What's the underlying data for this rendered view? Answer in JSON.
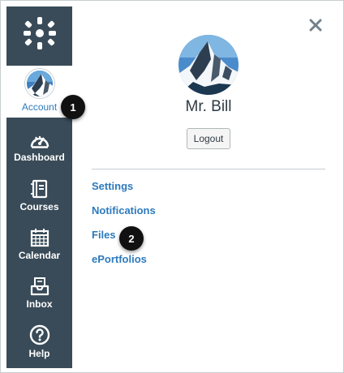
{
  "nav": {
    "logo_icon": "canvas-logo-icon",
    "account": {
      "label": "Account",
      "icon": "user-avatar"
    },
    "items": [
      {
        "label": "Dashboard",
        "icon": "dashboard-gauge-icon"
      },
      {
        "label": "Courses",
        "icon": "courses-book-icon"
      },
      {
        "label": "Calendar",
        "icon": "calendar-icon"
      },
      {
        "label": "Inbox",
        "icon": "inbox-tray-icon"
      },
      {
        "label": "Help",
        "icon": "help-question-icon"
      }
    ]
  },
  "tray": {
    "close_icon": "close-x-icon",
    "user_name": "Mr. Bill",
    "logout_label": "Logout",
    "links": [
      "Settings",
      "Notifications",
      "Files",
      "ePortfolios"
    ]
  },
  "callouts": [
    "1",
    "2"
  ],
  "colors": {
    "nav_bg": "#394b58",
    "link": "#2d7abc",
    "text": "#2d3b45",
    "callout_bg": "#111111"
  }
}
